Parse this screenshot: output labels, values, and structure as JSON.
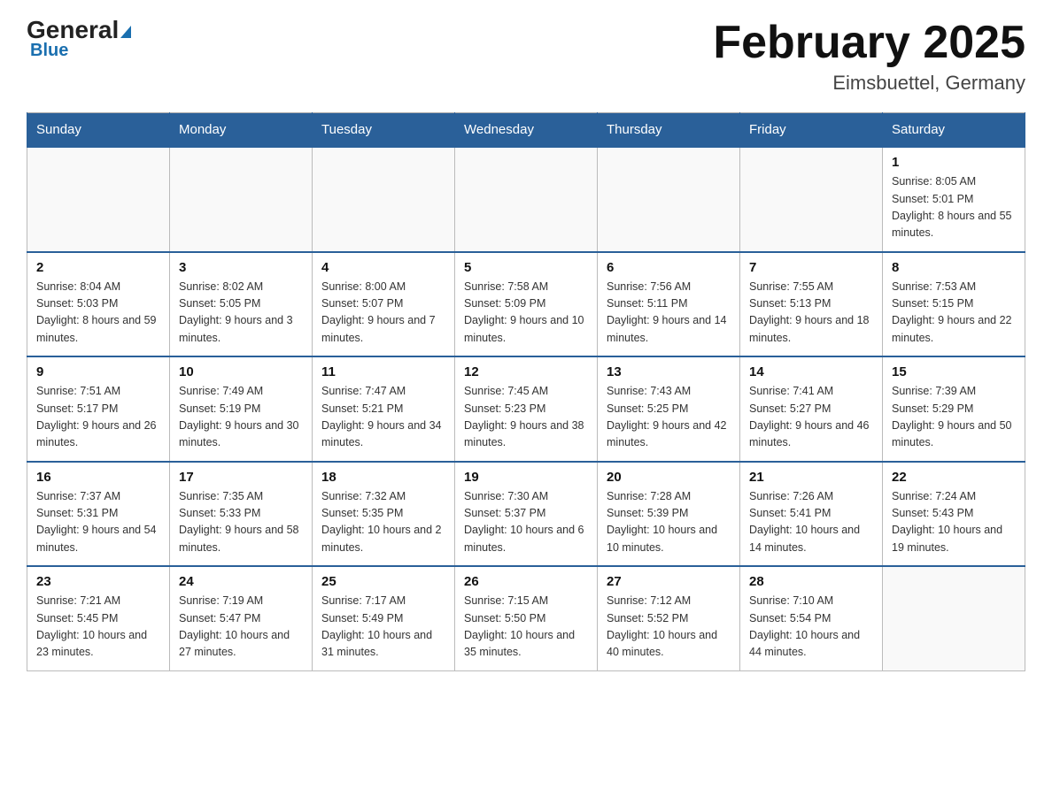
{
  "header": {
    "logo_text_general": "General",
    "logo_text_blue": "Blue",
    "title": "February 2025",
    "subtitle": "Eimsbuettel, Germany"
  },
  "days_of_week": [
    "Sunday",
    "Monday",
    "Tuesday",
    "Wednesday",
    "Thursday",
    "Friday",
    "Saturday"
  ],
  "weeks": [
    [
      {
        "day": "",
        "info": ""
      },
      {
        "day": "",
        "info": ""
      },
      {
        "day": "",
        "info": ""
      },
      {
        "day": "",
        "info": ""
      },
      {
        "day": "",
        "info": ""
      },
      {
        "day": "",
        "info": ""
      },
      {
        "day": "1",
        "info": "Sunrise: 8:05 AM\nSunset: 5:01 PM\nDaylight: 8 hours and 55 minutes."
      }
    ],
    [
      {
        "day": "2",
        "info": "Sunrise: 8:04 AM\nSunset: 5:03 PM\nDaylight: 8 hours and 59 minutes."
      },
      {
        "day": "3",
        "info": "Sunrise: 8:02 AM\nSunset: 5:05 PM\nDaylight: 9 hours and 3 minutes."
      },
      {
        "day": "4",
        "info": "Sunrise: 8:00 AM\nSunset: 5:07 PM\nDaylight: 9 hours and 7 minutes."
      },
      {
        "day": "5",
        "info": "Sunrise: 7:58 AM\nSunset: 5:09 PM\nDaylight: 9 hours and 10 minutes."
      },
      {
        "day": "6",
        "info": "Sunrise: 7:56 AM\nSunset: 5:11 PM\nDaylight: 9 hours and 14 minutes."
      },
      {
        "day": "7",
        "info": "Sunrise: 7:55 AM\nSunset: 5:13 PM\nDaylight: 9 hours and 18 minutes."
      },
      {
        "day": "8",
        "info": "Sunrise: 7:53 AM\nSunset: 5:15 PM\nDaylight: 9 hours and 22 minutes."
      }
    ],
    [
      {
        "day": "9",
        "info": "Sunrise: 7:51 AM\nSunset: 5:17 PM\nDaylight: 9 hours and 26 minutes."
      },
      {
        "day": "10",
        "info": "Sunrise: 7:49 AM\nSunset: 5:19 PM\nDaylight: 9 hours and 30 minutes."
      },
      {
        "day": "11",
        "info": "Sunrise: 7:47 AM\nSunset: 5:21 PM\nDaylight: 9 hours and 34 minutes."
      },
      {
        "day": "12",
        "info": "Sunrise: 7:45 AM\nSunset: 5:23 PM\nDaylight: 9 hours and 38 minutes."
      },
      {
        "day": "13",
        "info": "Sunrise: 7:43 AM\nSunset: 5:25 PM\nDaylight: 9 hours and 42 minutes."
      },
      {
        "day": "14",
        "info": "Sunrise: 7:41 AM\nSunset: 5:27 PM\nDaylight: 9 hours and 46 minutes."
      },
      {
        "day": "15",
        "info": "Sunrise: 7:39 AM\nSunset: 5:29 PM\nDaylight: 9 hours and 50 minutes."
      }
    ],
    [
      {
        "day": "16",
        "info": "Sunrise: 7:37 AM\nSunset: 5:31 PM\nDaylight: 9 hours and 54 minutes."
      },
      {
        "day": "17",
        "info": "Sunrise: 7:35 AM\nSunset: 5:33 PM\nDaylight: 9 hours and 58 minutes."
      },
      {
        "day": "18",
        "info": "Sunrise: 7:32 AM\nSunset: 5:35 PM\nDaylight: 10 hours and 2 minutes."
      },
      {
        "day": "19",
        "info": "Sunrise: 7:30 AM\nSunset: 5:37 PM\nDaylight: 10 hours and 6 minutes."
      },
      {
        "day": "20",
        "info": "Sunrise: 7:28 AM\nSunset: 5:39 PM\nDaylight: 10 hours and 10 minutes."
      },
      {
        "day": "21",
        "info": "Sunrise: 7:26 AM\nSunset: 5:41 PM\nDaylight: 10 hours and 14 minutes."
      },
      {
        "day": "22",
        "info": "Sunrise: 7:24 AM\nSunset: 5:43 PM\nDaylight: 10 hours and 19 minutes."
      }
    ],
    [
      {
        "day": "23",
        "info": "Sunrise: 7:21 AM\nSunset: 5:45 PM\nDaylight: 10 hours and 23 minutes."
      },
      {
        "day": "24",
        "info": "Sunrise: 7:19 AM\nSunset: 5:47 PM\nDaylight: 10 hours and 27 minutes."
      },
      {
        "day": "25",
        "info": "Sunrise: 7:17 AM\nSunset: 5:49 PM\nDaylight: 10 hours and 31 minutes."
      },
      {
        "day": "26",
        "info": "Sunrise: 7:15 AM\nSunset: 5:50 PM\nDaylight: 10 hours and 35 minutes."
      },
      {
        "day": "27",
        "info": "Sunrise: 7:12 AM\nSunset: 5:52 PM\nDaylight: 10 hours and 40 minutes."
      },
      {
        "day": "28",
        "info": "Sunrise: 7:10 AM\nSunset: 5:54 PM\nDaylight: 10 hours and 44 minutes."
      },
      {
        "day": "",
        "info": ""
      }
    ]
  ]
}
